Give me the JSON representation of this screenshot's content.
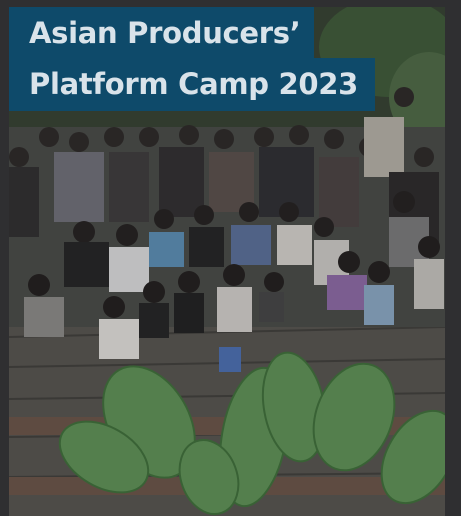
{
  "card": {
    "title_line1": "Asian Producers’",
    "title_line2": "Platform Camp 2023"
  },
  "photo": {
    "subject": "group-photo",
    "colors": {
      "deck": "#5a5a57",
      "foliage": "#3f6a3c",
      "leaf": "#6b9a63",
      "title_bg": "#0e4a6a",
      "title_text": "#d9e3ea"
    }
  }
}
